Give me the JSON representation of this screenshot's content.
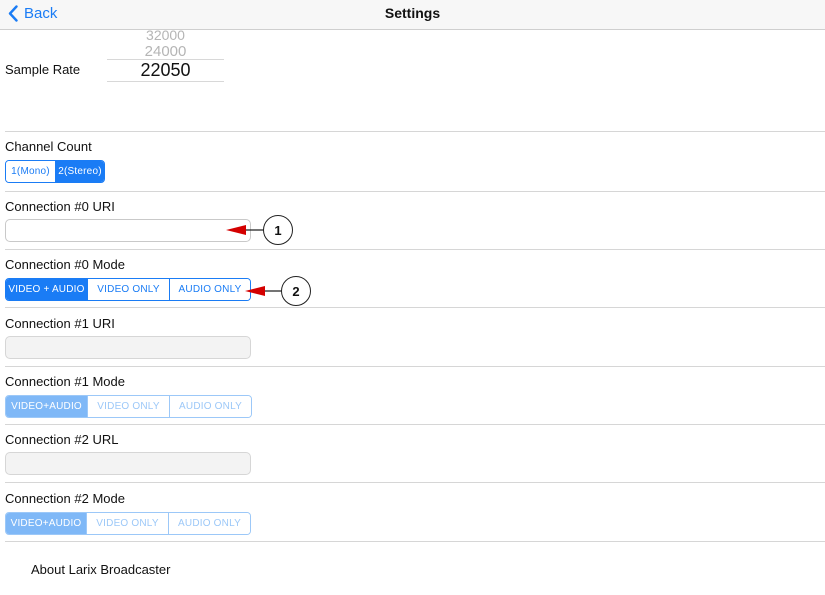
{
  "nav": {
    "back_label": "Back",
    "title": "Settings"
  },
  "sample_rate": {
    "label": "Sample Rate",
    "options_above": [
      "32000",
      "24000"
    ],
    "selected": "22050"
  },
  "channel_count": {
    "label": "Channel Count",
    "options": [
      "1(Mono)",
      "2(Stereo)"
    ],
    "selected_index": 1
  },
  "connection0": {
    "uri_label": "Connection #0 URI",
    "uri_value": "",
    "mode_label": "Connection #0 Mode",
    "modes": [
      "VIDEO + AUDIO",
      "VIDEO ONLY",
      "AUDIO ONLY"
    ],
    "selected_index": 0
  },
  "connection1": {
    "uri_label": "Connection #1 URI",
    "uri_value": "",
    "mode_label": "Connection #1 Mode",
    "modes": [
      "VIDEO+AUDIO",
      "VIDEO ONLY",
      "AUDIO ONLY"
    ],
    "selected_index": 0
  },
  "connection2": {
    "uri_label": "Connection #2 URL",
    "uri_value": "",
    "mode_label": "Connection #2 Mode",
    "modes": [
      "VIDEO+AUDIO",
      "VIDEO ONLY",
      "AUDIO ONLY"
    ],
    "selected_index": 0
  },
  "callouts": [
    "1",
    "2"
  ],
  "about_label": "About Larix Broadcaster",
  "colors": {
    "accent": "#1a7cf5",
    "accent_faded": "#9cc8f8",
    "callout_arrow": "#d40000"
  }
}
